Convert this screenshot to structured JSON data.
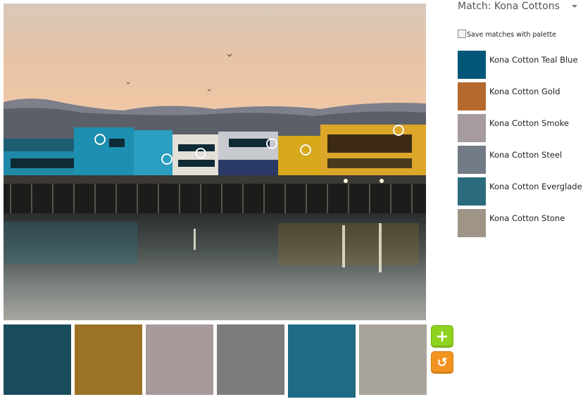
{
  "photo": {
    "pickers": [
      {
        "name": "picker-teal-blue"
      },
      {
        "name": "picker-gold"
      },
      {
        "name": "picker-smoke"
      },
      {
        "name": "picker-steel"
      },
      {
        "name": "picker-everglade"
      },
      {
        "name": "picker-stone"
      }
    ]
  },
  "palette": [
    {
      "color": "#194c5c"
    },
    {
      "color": "#9b7227"
    },
    {
      "color": "#a8999a"
    },
    {
      "color": "#7a7d7a"
    },
    {
      "color": "#1f6b84"
    },
    {
      "color": "#a9a49c"
    }
  ],
  "actions": {
    "add_icon": "+",
    "reset_icon": "↺"
  },
  "panel": {
    "header": "Match: Kona Cottons",
    "save_label": "Save matches with palette",
    "matches": [
      {
        "label": "Kona Cotton Teal Blue",
        "color": "#035677"
      },
      {
        "label": "Kona Cotton Gold",
        "color": "#b36a2c"
      },
      {
        "label": "Kona Cotton Smoke",
        "color": "#a69b9d"
      },
      {
        "label": "Kona Cotton Steel",
        "color": "#727b86"
      },
      {
        "label": "Kona Cotton Everglade",
        "color": "#2b6b7d"
      },
      {
        "label": "Kona Cotton Stone",
        "color": "#9f9587"
      }
    ]
  }
}
